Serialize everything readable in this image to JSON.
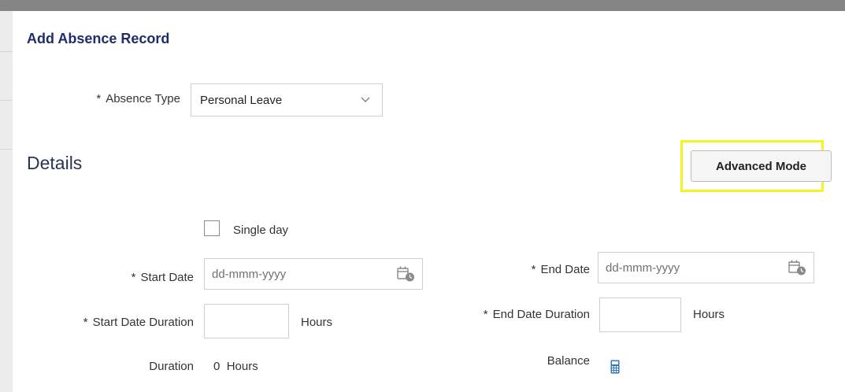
{
  "dialog": {
    "title": "Add Absence Record"
  },
  "absence_type": {
    "label": "Absence Type",
    "required_mark": "*",
    "value": "Personal Leave",
    "icon": "chevron-down-icon"
  },
  "details": {
    "heading": "Details",
    "advanced_mode_label": "Advanced Mode",
    "single_day_label": "Single day",
    "single_day_checked": false,
    "start_date": {
      "label": "Start Date",
      "required_mark": "*",
      "placeholder": "dd-mmm-yyyy",
      "icon": "calendar-icon"
    },
    "end_date": {
      "label": "End Date",
      "required_mark": "*",
      "placeholder": "dd-mmm-yyyy",
      "icon": "calendar-icon"
    },
    "start_date_duration": {
      "label": "Start Date Duration",
      "required_mark": "*",
      "value": "",
      "unit": "Hours"
    },
    "end_date_duration": {
      "label": "End Date Duration",
      "required_mark": "*",
      "value": "",
      "unit": "Hours"
    },
    "duration": {
      "label": "Duration",
      "value": "0",
      "unit": "Hours"
    },
    "balance": {
      "label": "Balance",
      "icon": "calculator-icon"
    }
  },
  "colors": {
    "title": "#1f2d6b",
    "highlight": "#f7f223",
    "calculator": "#2f78c4"
  }
}
